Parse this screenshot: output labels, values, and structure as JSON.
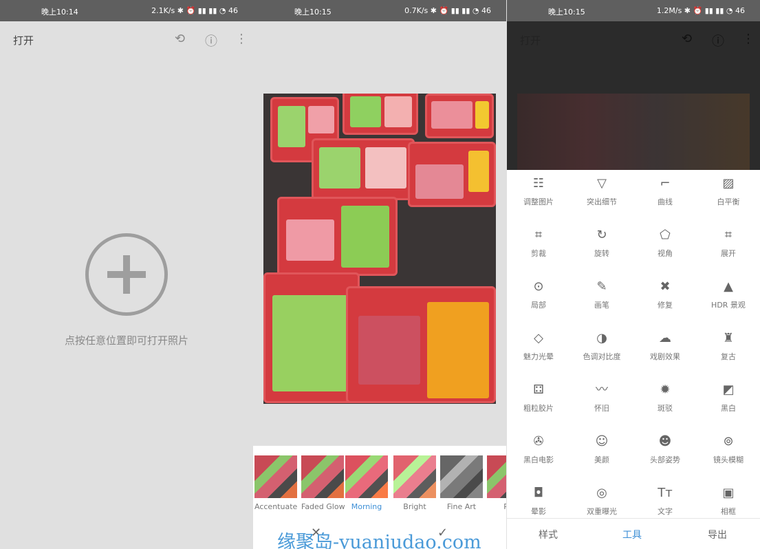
{
  "screens": [
    {
      "time": "晚上10:14",
      "net": "2.1K/s ✱ ⏰ ▮▮ ▮▮ ◔ 46"
    },
    {
      "time": "晚上10:15",
      "net": "0.7K/s ✱ ⏰ ▮▮ ▮▮ ◔ 46"
    },
    {
      "time": "晚上10:15",
      "net": "1.2M/s ✱ ⏰ ▮▮ ▮▮ ◔ 46"
    }
  ],
  "appbar": {
    "title": "打开"
  },
  "open": {
    "hint": "点按任意位置即可打开照片"
  },
  "filters": [
    {
      "label": "Accentuate"
    },
    {
      "label": "Faded Glow"
    },
    {
      "label": "Morning",
      "selected": true
    },
    {
      "label": "Bright"
    },
    {
      "label": "Fine Art"
    },
    {
      "label": "Pu"
    }
  ],
  "filter_actions": {
    "cancel": "✕",
    "apply": "✓"
  },
  "watermark": "缘聚岛-yuanjudao.com",
  "tools": [
    {
      "label": "调整图片",
      "icon": "tune-icon",
      "g": "☷"
    },
    {
      "label": "突出细节",
      "icon": "details-icon",
      "g": "▽"
    },
    {
      "label": "曲线",
      "icon": "curves-icon",
      "g": "⌐"
    },
    {
      "label": "白平衡",
      "icon": "white-balance-icon",
      "g": "▨"
    },
    {
      "label": "剪裁",
      "icon": "crop-icon",
      "g": "⌗"
    },
    {
      "label": "旋转",
      "icon": "rotate-icon",
      "g": "↻"
    },
    {
      "label": "视角",
      "icon": "perspective-icon",
      "g": "⬠"
    },
    {
      "label": "展开",
      "icon": "expand-icon",
      "g": "⌗"
    },
    {
      "label": "局部",
      "icon": "selective-icon",
      "g": "⊙"
    },
    {
      "label": "画笔",
      "icon": "brush-icon",
      "g": "✎"
    },
    {
      "label": "修复",
      "icon": "healing-icon",
      "g": "✖"
    },
    {
      "label": "HDR 景观",
      "icon": "hdr-icon",
      "g": "▲"
    },
    {
      "label": "魅力光晕",
      "icon": "glamour-icon",
      "g": "◇"
    },
    {
      "label": "色调对比度",
      "icon": "tonal-contrast-icon",
      "g": "◑"
    },
    {
      "label": "戏剧效果",
      "icon": "drama-icon",
      "g": "☁"
    },
    {
      "label": "复古",
      "icon": "vintage-icon",
      "g": "♜"
    },
    {
      "label": "粗粒胶片",
      "icon": "grainy-film-icon",
      "g": "⚃"
    },
    {
      "label": "怀旧",
      "icon": "retrolux-icon",
      "g": "〰"
    },
    {
      "label": "斑驳",
      "icon": "grunge-icon",
      "g": "✹"
    },
    {
      "label": "黑白",
      "icon": "black-white-icon",
      "g": "◩"
    },
    {
      "label": "黑白电影",
      "icon": "noir-icon",
      "g": "✇"
    },
    {
      "label": "美颜",
      "icon": "face-icon",
      "g": "☺"
    },
    {
      "label": "头部姿势",
      "icon": "head-pose-icon",
      "g": "☻"
    },
    {
      "label": "镜头模糊",
      "icon": "lens-blur-icon",
      "g": "⊚"
    },
    {
      "label": "晕影",
      "icon": "vignette-icon",
      "g": "◘"
    },
    {
      "label": "双重曝光",
      "icon": "double-exposure-icon",
      "g": "◎"
    },
    {
      "label": "文字",
      "icon": "text-icon",
      "g": "Tт"
    },
    {
      "label": "相框",
      "icon": "frame-icon",
      "g": "▣"
    }
  ],
  "bottom_nav": [
    {
      "label": "样式"
    },
    {
      "label": "工具",
      "active": true
    },
    {
      "label": "导出"
    }
  ],
  "colors": {
    "accent": "#3d8fd6",
    "statusbar": "#5f5f5f"
  }
}
